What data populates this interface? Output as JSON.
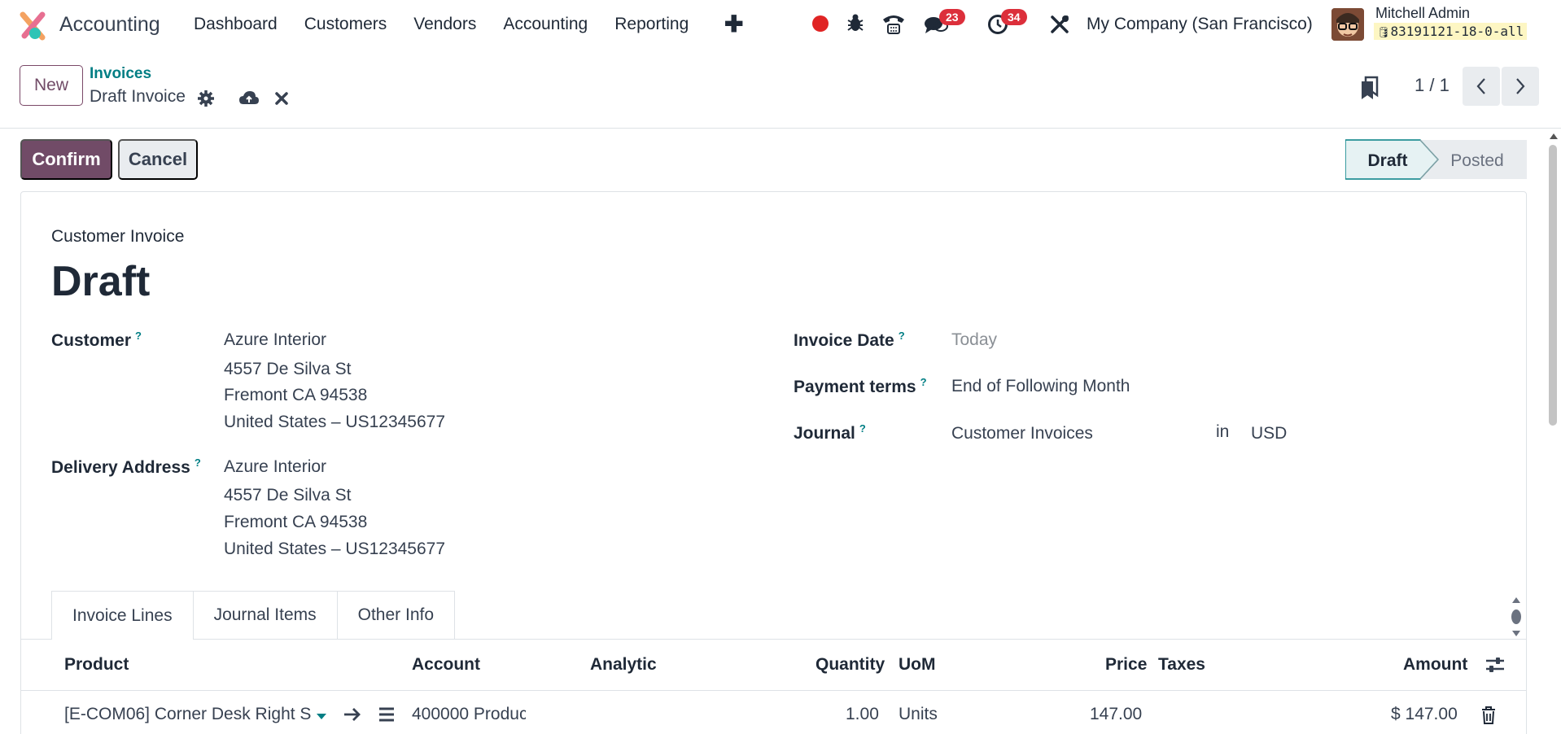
{
  "navbar": {
    "app_name": "Accounting",
    "menu": [
      "Dashboard",
      "Customers",
      "Vendors",
      "Accounting",
      "Reporting"
    ],
    "plus_icon": "plus-icon",
    "messages_count": "23",
    "activities_count": "34",
    "company": "My Company (San Francisco)",
    "user_name": "Mitchell Admin",
    "db_name": "83191121-18-0-all"
  },
  "control": {
    "new_label": "New",
    "breadcrumb_parent": "Invoices",
    "breadcrumb_current": "Draft Invoice",
    "pager": "1 / 1"
  },
  "actions": {
    "confirm_label": "Confirm",
    "cancel_label": "Cancel",
    "status_steps": [
      "Draft",
      "Posted"
    ],
    "active_status": "Draft"
  },
  "form": {
    "type_label": "Customer Invoice",
    "title": "Draft",
    "customer_label": "Customer",
    "customer_lines": [
      "Azure Interior",
      "4557 De Silva St",
      "Fremont CA 94538",
      "United States – US12345677"
    ],
    "delivery_label": "Delivery Address",
    "delivery_lines": [
      "Azure Interior",
      "4557 De Silva St",
      "Fremont CA 94538",
      "United States – US12345677"
    ],
    "invoice_date_label": "Invoice Date",
    "invoice_date_placeholder": "Today",
    "payment_terms_label": "Payment terms",
    "payment_terms_value": "End of Following Month",
    "journal_label": "Journal",
    "journal_value": "Customer Invoices",
    "journal_in": "in",
    "currency": "USD",
    "help_mark": "?"
  },
  "tabs": [
    "Invoice Lines",
    "Journal Items",
    "Other Info"
  ],
  "table": {
    "headers": {
      "product": "Product",
      "account": "Account",
      "analytic": "Analytic",
      "quantity": "Quantity",
      "uom": "UoM",
      "price": "Price",
      "taxes": "Taxes",
      "amount": "Amount"
    },
    "rows": [
      {
        "product": "[E-COM06] Corner Desk Right S",
        "account": "400000 Produc",
        "quantity": "1.00",
        "uom": "Units",
        "price": "147.00",
        "amount": "$ 147.00"
      }
    ]
  },
  "colors": {
    "brand": "#714b67",
    "link": "#017e84",
    "badge": "#dc2f3b"
  }
}
